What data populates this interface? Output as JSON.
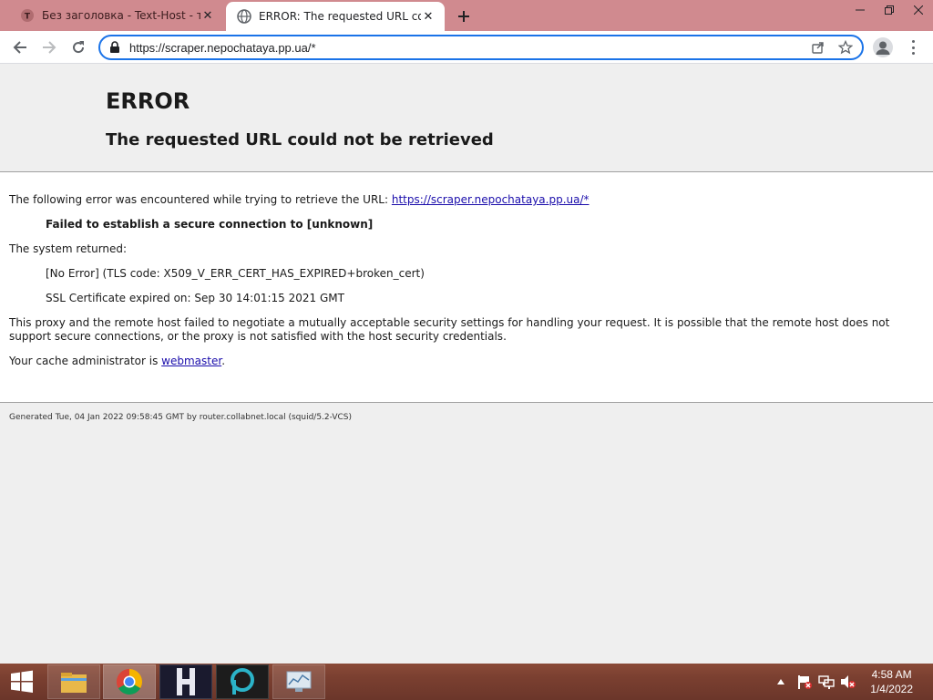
{
  "browser": {
    "tabs": [
      {
        "title": "Без заголовка - Text-Host - текс",
        "active": false,
        "favicon": "text-host-icon"
      },
      {
        "title": "ERROR: The requested URL could",
        "active": true,
        "favicon": "globe-icon"
      }
    ],
    "new_tab_label": "+",
    "address_bar": {
      "url": "https://scraper.nepochataya.pp.ua/*",
      "accent_color": "#1a73e8"
    }
  },
  "page": {
    "heading": "ERROR",
    "subheading": "The requested URL could not be retrieved",
    "intro": "The following error was encountered while trying to retrieve the URL: ",
    "intro_link": "https://scraper.nepochataya.pp.ua/*",
    "failure": "Failed to establish a secure connection to [unknown]",
    "system_returned": "The system returned:",
    "error_detail": "[No Error] (TLS code: X509_V_ERR_CERT_HAS_EXPIRED+broken_cert)",
    "cert_expiry": "SSL Certificate expired on: Sep 30 14:01:15 2021 GMT",
    "explanation_1": "This proxy and the remote host failed to negotiate a mutually acceptable security settings for handling your request. It is possible that the remote host does not",
    "explanation_2": "support secure connections, or the proxy is not satisfied with the host security credentials.",
    "admin_prefix": "Your cache administrator is ",
    "admin_link": "webmaster",
    "admin_suffix": ".",
    "footer": "Generated Tue, 04 Jan 2022 09:58:45 GMT by router.collabnet.local (squid/5.2-VCS)"
  },
  "taskbar": {
    "apps": [
      "file-explorer-icon",
      "chrome-icon",
      "h-app-icon",
      "p-app-icon",
      "monitor-app-icon"
    ],
    "tray_icons": [
      "show-hidden-icons-chevron",
      "action-center-flag-icon",
      "network-icon",
      "volume-muted-icon"
    ],
    "time": "4:58 AM",
    "date": "1/4/2022"
  }
}
